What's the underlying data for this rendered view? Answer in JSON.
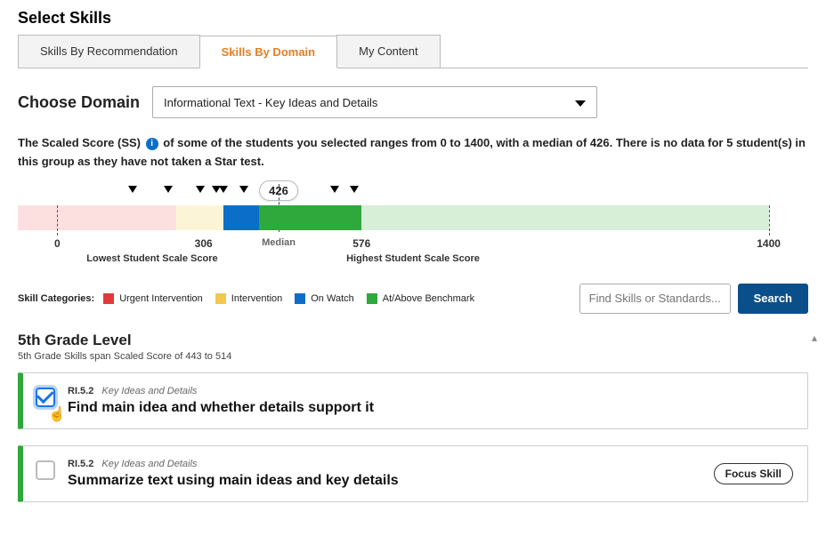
{
  "page_title": "Select Skills",
  "tabs": {
    "rec": "Skills By Recommendation",
    "domain": "Skills By Domain",
    "mycontent": "My Content"
  },
  "choose": {
    "label": "Choose Domain",
    "selected": "Informational Text - Key Ideas and Details"
  },
  "desc": {
    "part1": "The Scaled Score (SS)",
    "part2": " of some of the students you selected ranges from 0 to 1400, with a median of ",
    "median": "426.",
    "part3": " There is no data for 5 student(s) in this group as they have not taken a Star test."
  },
  "scale": {
    "median_value": "426",
    "median_label": "Median",
    "low_tick": "0",
    "lowscore_tick": "306",
    "highscore_tick": "576",
    "max_tick": "1400",
    "low_label": "Lowest Student Scale Score",
    "high_label": "Highest Student Scale Score"
  },
  "legend": {
    "title": "Skill Categories:",
    "urgent": "Urgent Intervention",
    "interv": "Intervention",
    "onwatch": "On Watch",
    "above": "At/Above Benchmark"
  },
  "search": {
    "placeholder": "Find Skills or Standards...",
    "button": "Search"
  },
  "grade": {
    "heading": "5th Grade Level",
    "sub": "5th Grade Skills span Scaled Score of 443 to 514"
  },
  "skills": [
    {
      "code": "RI.5.2",
      "domain": "Key Ideas and Details",
      "title": "Find main idea and whether details support it",
      "checked": true,
      "focus": false
    },
    {
      "code": "RI.5.2",
      "domain": "Key Ideas and Details",
      "title": "Summarize text using main ideas and key details",
      "checked": false,
      "focus": true
    }
  ],
  "focus_label": "Focus Skill",
  "chart_data": {
    "type": "bar",
    "title": "Student Scaled Score Distribution",
    "xlabel": "Scaled Score",
    "xlim": [
      0,
      1400
    ],
    "median": 426,
    "lowest_student": 306,
    "highest_student": 576,
    "category_bands": [
      {
        "name": "Urgent Intervention",
        "range": [
          0,
          280
        ],
        "color": "#fce0e0"
      },
      {
        "name": "Intervention",
        "range": [
          280,
          365
        ],
        "color": "#fcf4d6"
      },
      {
        "name": "On Watch",
        "range": [
          365,
          430
        ],
        "color": "#0b6ec8"
      },
      {
        "name": "At/Above Benchmark",
        "range": [
          430,
          1400
        ],
        "color": "#2fa83c"
      }
    ],
    "student_markers_approx": [
      175,
      235,
      295,
      320,
      335,
      365,
      520,
      555
    ],
    "no_data_students": 5
  }
}
